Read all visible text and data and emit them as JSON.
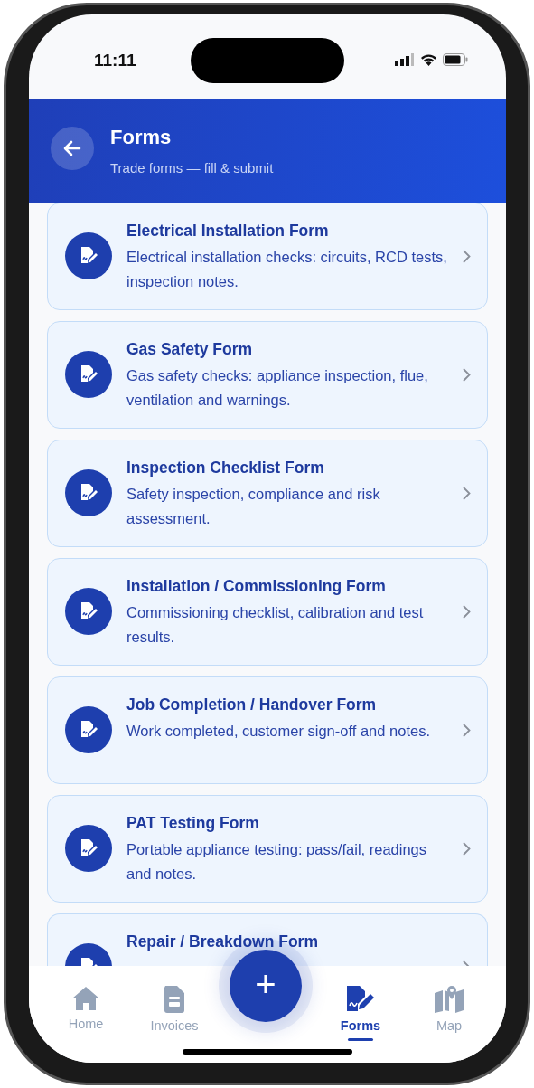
{
  "status_bar": {
    "time": "11:11"
  },
  "header": {
    "title": "Forms",
    "subtitle": "Trade forms — fill & submit"
  },
  "forms": [
    {
      "title": "Electrical Installation Form",
      "description": "Electrical installation checks: circuits, RCD tests, inspection notes."
    },
    {
      "title": "Gas Safety Form",
      "description": "Gas safety checks: appliance inspection, flue, ventilation and warnings."
    },
    {
      "title": "Inspection Checklist Form",
      "description": "Safety inspection, compliance and risk assessment."
    },
    {
      "title": "Installation / Commissioning Form",
      "description": "Commissioning checklist, calibration and test results."
    },
    {
      "title": "Job Completion / Handover Form",
      "description": "Work completed, customer sign-off and notes."
    },
    {
      "title": "PAT Testing Form",
      "description": "Portable appliance testing: pass/fail, readings and notes."
    },
    {
      "title": "Repair / Breakdown Form"
    }
  ],
  "fab": {
    "label": "+"
  },
  "nav": [
    {
      "label": "Home",
      "selected": false
    },
    {
      "label": "Invoices",
      "selected": false
    },
    {
      "label": "Forms",
      "selected": true
    },
    {
      "label": "Map",
      "selected": false
    }
  ]
}
